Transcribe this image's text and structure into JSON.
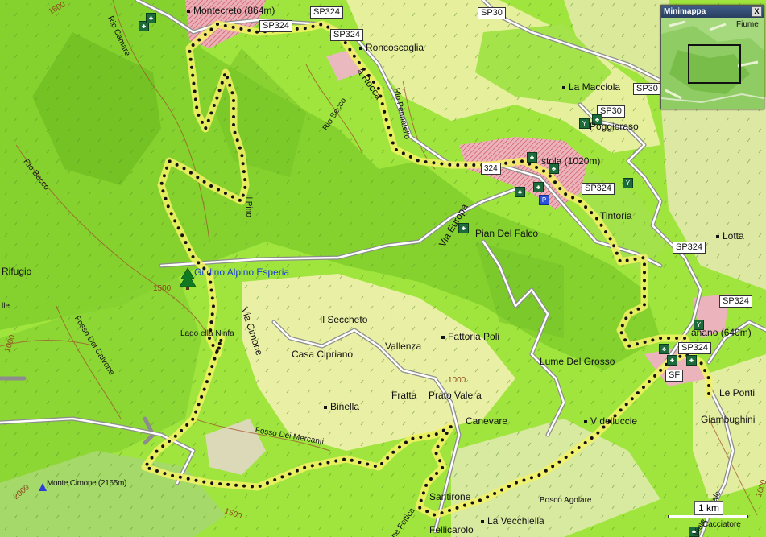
{
  "map": {
    "places": [
      {
        "name": "Montecreto (864m)",
        "key": "montecreto"
      },
      {
        "name": "Roncoscaglia",
        "key": "roncoscaglia"
      },
      {
        "name": "La Macciola",
        "key": "lamacciola"
      },
      {
        "name": "Poggioraso",
        "key": "poggioraso"
      },
      {
        "name": "stola (1020m)",
        "key": "sestola"
      },
      {
        "name": "Tintoria",
        "key": "tintoria"
      },
      {
        "name": "Lotta",
        "key": "lotta"
      },
      {
        "name": "Pian Del Falco",
        "key": "piandelfalco"
      },
      {
        "name": "Il Seccheto",
        "key": "seccheto"
      },
      {
        "name": "Casa Cipriano",
        "key": "casacipriano"
      },
      {
        "name": "Fattoria Poli",
        "key": "fattoriapoli"
      },
      {
        "name": "Vallenza",
        "key": "vallenza"
      },
      {
        "name": "Lume Del Grosso",
        "key": "lume"
      },
      {
        "name": "Fratta",
        "key": "fratta"
      },
      {
        "name": "Prato Valera",
        "key": "pratovalera"
      },
      {
        "name": "Binella",
        "key": "binella"
      },
      {
        "name": "Canevare",
        "key": "canevare"
      },
      {
        "name": "V  delluccie",
        "key": "vdelluccie"
      },
      {
        "name": "Santirone",
        "key": "santirone"
      },
      {
        "name": "Bosco Agolare",
        "key": "boscoagolare"
      },
      {
        "name": "La Vecchiella",
        "key": "lavecchiella"
      },
      {
        "name": "Fellicarolo",
        "key": "fellicarolo"
      },
      {
        "name": "anano (640m)",
        "key": "fanano"
      },
      {
        "name": "Le Ponti",
        "key": "leponti"
      },
      {
        "name": "Giambughini",
        "key": "giambughini"
      },
      {
        "name": "Lago    ella  Ninfa",
        "key": "lago"
      },
      {
        "name": "Rifugio",
        "key": "rifugio"
      },
      {
        "name": "lle",
        "key": "lle"
      },
      {
        "name": "Monte Cimone (2165m)",
        "key": "cimone"
      },
      {
        "name": "Cacciatore",
        "key": "cacciatore"
      }
    ],
    "roads": [
      "SP324",
      "SP324",
      "SP30",
      "SP30",
      "SP30",
      "SP324",
      "SP324",
      "SP324",
      "SP324",
      "SP324",
      "SF"
    ],
    "waterways": [
      "Rio Camare",
      "Rio Becco",
      "Rio Secco",
      "Rio Pennatello",
      "Fosso Del Calvone",
      "Fosso Dei Mercanti",
      "Il Pino"
    ],
    "streets": [
      "Via Cimone",
      "Via Europa",
      "a Rocca",
      "Viale Ospitale",
      "ne Feltica"
    ],
    "contours": [
      "1500",
      "1600",
      "1500",
      "1000",
      "1000",
      "2000",
      "1000",
      "1500",
      "1500",
      "1000"
    ],
    "highlight": "Gi  dino Alpino Esperia",
    "minimap": {
      "title": "Minimappa",
      "close": "X",
      "label": "Fiume"
    },
    "scale": "1 km"
  }
}
